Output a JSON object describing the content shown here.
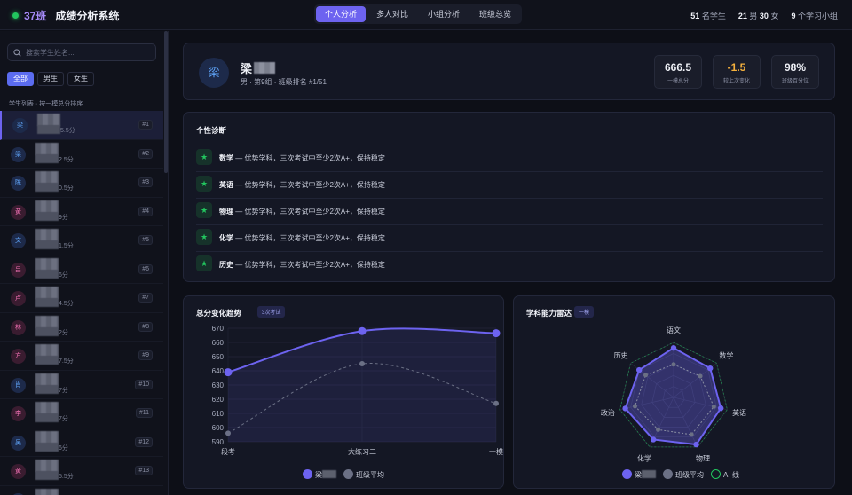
{
  "header": {
    "class_name": "37班",
    "app_title": "成绩分析系统",
    "tabs": [
      {
        "label": "个人分析",
        "active": true
      },
      {
        "label": "多人对比",
        "active": false
      },
      {
        "label": "小组分析",
        "active": false
      },
      {
        "label": "班级总览",
        "active": false
      }
    ],
    "stats": {
      "students_count": "51",
      "students_label": "名学生",
      "male_count": "21",
      "male_label": "男",
      "female_count": "30",
      "female_label": "女",
      "groups_count": "9",
      "groups_label": "个学习小组"
    }
  },
  "sidebar": {
    "search_placeholder": "搜索学生姓名...",
    "filters": [
      {
        "label": "全部",
        "active": true
      },
      {
        "label": "男生",
        "active": false
      },
      {
        "label": "女生",
        "active": false
      }
    ],
    "list_header": "学生列表 · 按一模总分排序",
    "students": [
      {
        "initial": "梁",
        "score": "5.5分",
        "rank": "#1",
        "color": "#60a5fa",
        "bg": "#1d2a4a"
      },
      {
        "initial": "梁",
        "score": "2.5分",
        "rank": "#2",
        "color": "#60a5fa",
        "bg": "#1d2a4a"
      },
      {
        "initial": "陈",
        "score": "0.5分",
        "rank": "#3",
        "color": "#60a5fa",
        "bg": "#1d2a4a"
      },
      {
        "initial": "黄",
        "score": "9分",
        "rank": "#4",
        "color": "#f472b6",
        "bg": "#3a1c30"
      },
      {
        "initial": "文",
        "score": "1.5分",
        "rank": "#5",
        "color": "#60a5fa",
        "bg": "#1d2a4a"
      },
      {
        "initial": "吕",
        "score": "6分",
        "rank": "#6",
        "color": "#f472b6",
        "bg": "#3a1c30"
      },
      {
        "initial": "卢",
        "score": "4.5分",
        "rank": "#7",
        "color": "#f472b6",
        "bg": "#3a1c30"
      },
      {
        "initial": "林",
        "score": "2分",
        "rank": "#8",
        "color": "#f472b6",
        "bg": "#3a1c30"
      },
      {
        "initial": "方",
        "score": "7.5分",
        "rank": "#9",
        "color": "#f472b6",
        "bg": "#3a1c30"
      },
      {
        "initial": "肖",
        "score": "7分",
        "rank": "#10",
        "color": "#60a5fa",
        "bg": "#1d2a4a"
      },
      {
        "initial": "李",
        "score": "7分",
        "rank": "#11",
        "color": "#f472b6",
        "bg": "#3a1c30"
      },
      {
        "initial": "吴",
        "score": "6分",
        "rank": "#12",
        "color": "#60a5fa",
        "bg": "#1d2a4a"
      },
      {
        "initial": "黄",
        "score": "5.5分",
        "rank": "#13",
        "color": "#f472b6",
        "bg": "#3a1c30"
      },
      {
        "initial": "",
        "score": "",
        "rank": "",
        "color": "#60a5fa",
        "bg": "#1d2a4a"
      }
    ]
  },
  "profile": {
    "initial": "梁",
    "name_visible": "梁",
    "meta": "男 · 第9组 · 班级排名 #1/51",
    "kpis": [
      {
        "value": "666.5",
        "label": "一模总分",
        "color": "#eef0f6"
      },
      {
        "value": "-1.5",
        "label": "较上次变化",
        "color": "#f5b13d"
      },
      {
        "value": "98%",
        "label": "班级百分位",
        "color": "#eef0f6"
      }
    ]
  },
  "diagnosis": {
    "title": "个性诊断",
    "items": [
      {
        "subject": "数学",
        "text": " — 优势学科，三次考试中至少2次A+，保持稳定"
      },
      {
        "subject": "英语",
        "text": " — 优势学科，三次考试中至少2次A+，保持稳定"
      },
      {
        "subject": "物理",
        "text": " — 优势学科，三次考试中至少2次A+，保持稳定"
      },
      {
        "subject": "化学",
        "text": " — 优势学科，三次考试中至少2次A+，保持稳定"
      },
      {
        "subject": "历史",
        "text": " — 优势学科，三次考试中至少2次A+，保持稳定"
      }
    ]
  },
  "trend_card": {
    "title": "总分变化趋势",
    "badge": "3次考试",
    "legend_student": "梁",
    "legend_avg": "班级平均"
  },
  "radar_card": {
    "title": "学科能力雷达",
    "badge": "一模",
    "legend_student": "梁",
    "legend_avg": "班级平均",
    "legend_aplus": "A+线"
  },
  "chart_data": [
    {
      "type": "line",
      "title": "总分变化趋势",
      "categories": [
        "段考",
        "大练习二",
        "一模"
      ],
      "ylim": [
        590,
        670
      ],
      "yticks": [
        590,
        600,
        610,
        620,
        630,
        640,
        650,
        660,
        670
      ],
      "series": [
        {
          "name": "梁",
          "values": [
            639,
            668,
            666.5
          ],
          "color": "#6d63f0"
        },
        {
          "name": "班级平均",
          "values": [
            596,
            645,
            617
          ],
          "color": "#8a8fa3"
        }
      ]
    },
    {
      "type": "radar",
      "title": "学科能力雷达",
      "axes": [
        "语文",
        "数学",
        "英语",
        "物理",
        "化学",
        "政治",
        "历史"
      ],
      "series": [
        {
          "name": "梁",
          "values": [
            0.9,
            0.85,
            0.88,
            0.95,
            0.85,
            0.9,
            0.8
          ],
          "color": "#6d63f0"
        },
        {
          "name": "班级平均",
          "values": [
            0.6,
            0.62,
            0.75,
            0.75,
            0.65,
            0.72,
            0.65
          ],
          "color": "#8a8fa3"
        },
        {
          "name": "A+线",
          "values": [
            1,
            1,
            1,
            1,
            1,
            1,
            1
          ],
          "color": "#22c55e"
        }
      ]
    }
  ]
}
